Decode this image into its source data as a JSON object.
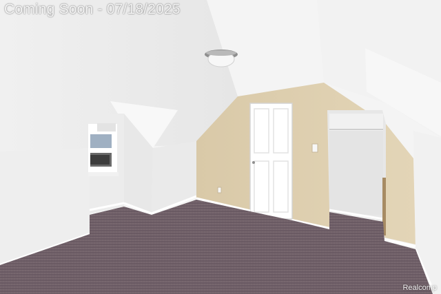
{
  "photo": {
    "watermark_text": "Coming Soon - 07/18/2025",
    "credit_text": "Realcomp"
  },
  "colors": {
    "ceiling": "#f4f4f4",
    "slope_wall": "#eeeeee",
    "beige_wall": "#dfd1b3",
    "carpet": "#6f5f66",
    "trim": "#ffffff"
  }
}
